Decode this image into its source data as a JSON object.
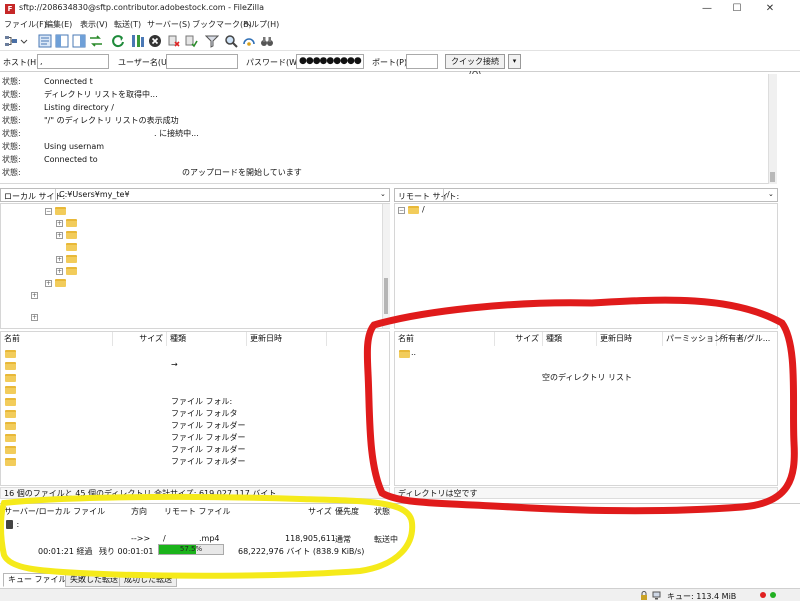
{
  "window": {
    "title": "sftp://208634830@sftp.contributor.adobestock.com - FileZilla",
    "app_icon_letter": "F",
    "min": "—",
    "max": "☐",
    "close": "✕"
  },
  "menu": [
    "ファイル(F)",
    "編集(E)",
    "表示(V)",
    "転送(T)",
    "サーバー(S)",
    "ブックマーク(B)",
    "ヘルプ(H)"
  ],
  "quickconnect": {
    "host_label": "ホスト(H):",
    "host_value": ",",
    "user_label": "ユーザー名(U):",
    "user_value": "",
    "password_label": "パスワード(W):",
    "password_value": "●●●●●●●●●",
    "port_label": "ポート(P):",
    "port_value": "",
    "connect_label": "クイック接続(Q)",
    "dropdown": "▾"
  },
  "log": [
    {
      "label": "状態:",
      "text": "Connected t"
    },
    {
      "label": "状態:",
      "text": "ディレクトリ リストを取得中..."
    },
    {
      "label": "状態:",
      "text": "Listing directory /"
    },
    {
      "label": "状態:",
      "text": "\"/\" のディレクトリ リストの表示成功"
    },
    {
      "label": "状態:",
      "text": ". に接続中..."
    },
    {
      "label": "状態:",
      "text": "Using usernam"
    },
    {
      "label": "状態:",
      "text": "Connected to"
    },
    {
      "label": "状態:",
      "text": "のアップロードを開始しています"
    }
  ],
  "local": {
    "site_label": "ローカル サイト:",
    "site_path": "C:¥Users¥my_te¥",
    "columns": [
      "名前",
      "サイズ",
      "種類",
      "更新日時"
    ],
    "rows": [
      {
        "type": ""
      },
      {
        "type": "→"
      },
      {
        "type": ""
      },
      {
        "type": ""
      },
      {
        "type": "ファイル フォル:"
      },
      {
        "type": "ファイル フォルタ"
      },
      {
        "type": "ファイル フォルダー"
      },
      {
        "type": "ファイル フォルダー"
      },
      {
        "type": "ファイル フォルダー"
      },
      {
        "type": "ファイル フォルダー"
      }
    ],
    "status": "16 個のファイルと 45 個のディレクトリ 合計サイズ: 619,027,117 バイト"
  },
  "remote": {
    "site_label": "リモート サイト:",
    "site_path": "/",
    "tree_root": "/",
    "columns": [
      "名前",
      "サイズ",
      "種類",
      "更新日時",
      "パーミッション",
      "所有者/グル..."
    ],
    "parent_row": "..",
    "empty_text": "空のディレクトリ リスト",
    "status": "ディレクトリは空です"
  },
  "queue": {
    "headers": [
      "サーバー/ローカル ファイル",
      "方向",
      "リモート ファイル",
      "サイズ",
      "優先度",
      "状態"
    ],
    "server_row": " :",
    "file": {
      "direction": "-->>",
      "remote": "/",
      "remote_ext": ".mp4",
      "size": "118,905,611",
      "priority": "通常",
      "state": "転送中"
    },
    "progress": {
      "elapsed": "00:01:21 経過",
      "remaining": "残り 00:01:01",
      "percent_text": "57.5%",
      "percent_value": 57.5,
      "bytes": "68,222,976 バイト (838.9 KiB/s)"
    }
  },
  "tabs": [
    "キュー ファイル (1)",
    "失敗した転送",
    "成功した転送"
  ],
  "statusbar": {
    "queue": "キュー: 113.4 MiB"
  },
  "colors": {
    "annotation_red": "#e01b1b",
    "annotation_yellow": "#f5ea1a",
    "progress_green": "#1bb31b",
    "folder": "#f2cc5b"
  }
}
